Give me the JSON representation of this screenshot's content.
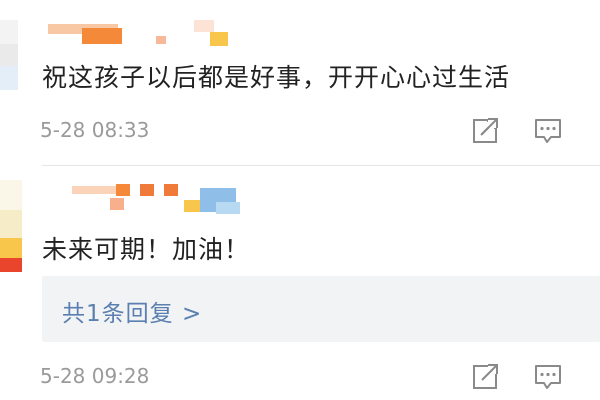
{
  "comments": [
    {
      "text": "祝这孩子以后都是好事，开开心心过生活",
      "timestamp": "5-28 08:33",
      "icons": {
        "share": "share-icon",
        "comment": "comment-icon"
      }
    },
    {
      "text": "未来可期！加油！",
      "reply_summary": "共1条回复 >",
      "timestamp": "5-28 09:28",
      "icons": {
        "share": "share-icon",
        "comment": "comment-icon"
      }
    }
  ],
  "colors": {
    "text": "#222222",
    "meta": "#9a9a9a",
    "link": "#5a7fb0",
    "reply_bg": "#f1f3f5",
    "censor_orange": "#f5893a",
    "censor_yellow": "#f7c64a",
    "censor_blue": "#8fbfe8"
  }
}
